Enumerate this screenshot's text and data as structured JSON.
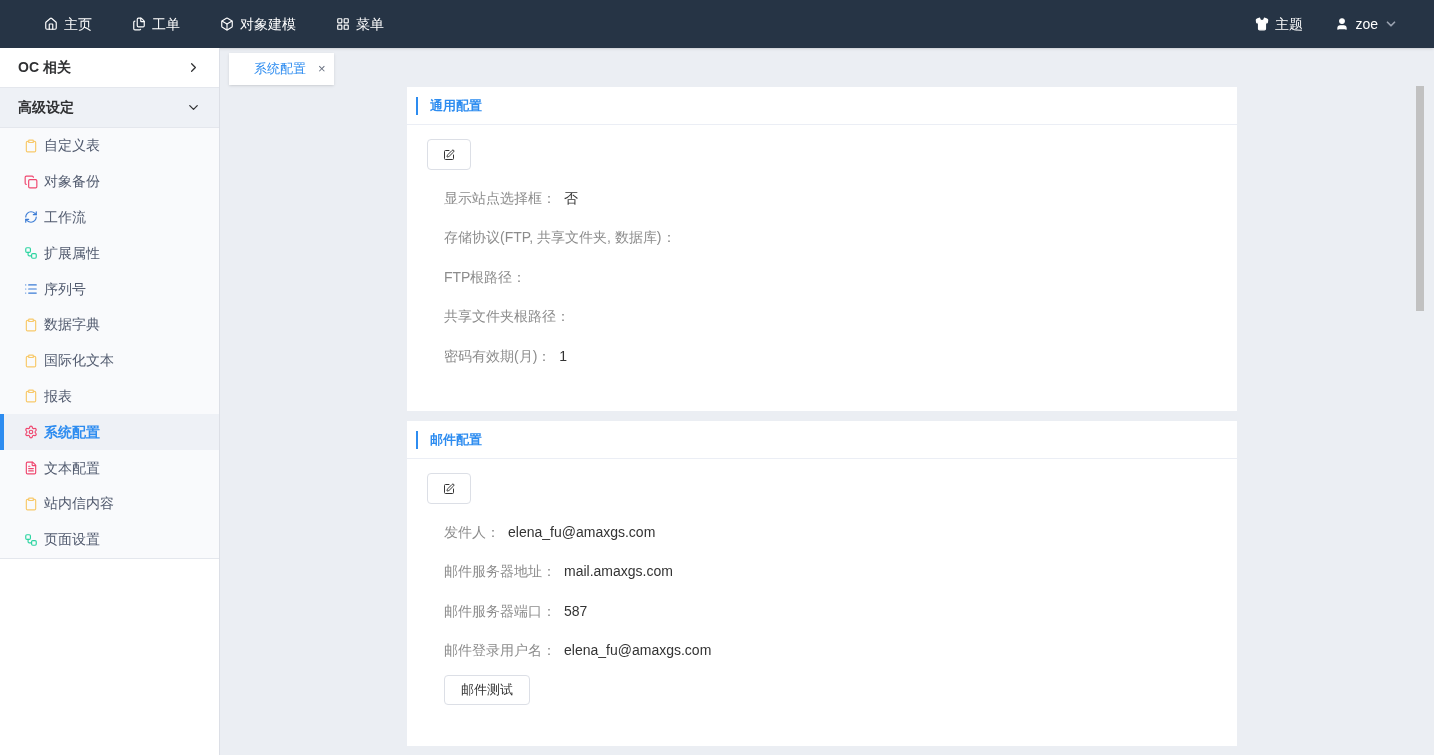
{
  "nav": [
    {
      "kind": "home",
      "label": "主页"
    },
    {
      "kind": "doc",
      "label": "工单"
    },
    {
      "kind": "cube",
      "label": "对象建模"
    },
    {
      "kind": "grid",
      "label": "菜单"
    }
  ],
  "theme": {
    "label": "主题"
  },
  "user": {
    "name": "zoe"
  },
  "sidebar": {
    "groups": [
      {
        "label": "OC 相关",
        "expanded": false
      },
      {
        "label": "高级设定",
        "expanded": true,
        "children": [
          {
            "kind": "clipboard",
            "label": "自定义表",
            "selected": false
          },
          {
            "kind": "copy",
            "label": "对象备份",
            "selected": false
          },
          {
            "kind": "cycle",
            "label": "工作流",
            "selected": false
          },
          {
            "kind": "nodes",
            "label": "扩展属性",
            "selected": false
          },
          {
            "kind": "list",
            "label": "序列号",
            "selected": false
          },
          {
            "kind": "clipboard",
            "label": "数据字典",
            "selected": false
          },
          {
            "kind": "clipboard",
            "label": "国际化文本",
            "selected": false
          },
          {
            "kind": "clipboard",
            "label": "报表",
            "selected": false
          },
          {
            "kind": "gear",
            "label": "系统配置",
            "selected": true
          },
          {
            "kind": "textdoc",
            "label": "文本配置",
            "selected": false
          },
          {
            "kind": "clipboard",
            "label": "站内信内容",
            "selected": false
          },
          {
            "kind": "nodes",
            "label": "页面设置",
            "selected": false
          }
        ]
      }
    ]
  },
  "tabs": [
    {
      "label": "系统配置",
      "close": "×",
      "selected": true
    }
  ],
  "sections": [
    {
      "title": "通用配置",
      "fields": [
        {
          "label": "显示站点选择框：",
          "value": "否"
        },
        {
          "label": "存储协议(FTP, 共享文件夹, 数据库)："
        },
        {
          "label": "FTP根路径："
        },
        {
          "label": "共享文件夹根路径："
        },
        {
          "label": "密码有效期(月)：",
          "value": "1"
        }
      ]
    },
    {
      "title": "邮件配置",
      "fields": [
        {
          "label": "发件人：",
          "value": "elena_fu@amaxgs.com"
        },
        {
          "label": "邮件服务器地址：",
          "value": "mail.amaxgs.com"
        },
        {
          "label": "邮件服务器端口：",
          "value": "587"
        },
        {
          "label": "邮件登录用户名：",
          "value": "elena_fu@amaxgs.com"
        }
      ],
      "button": "邮件测试"
    }
  ]
}
